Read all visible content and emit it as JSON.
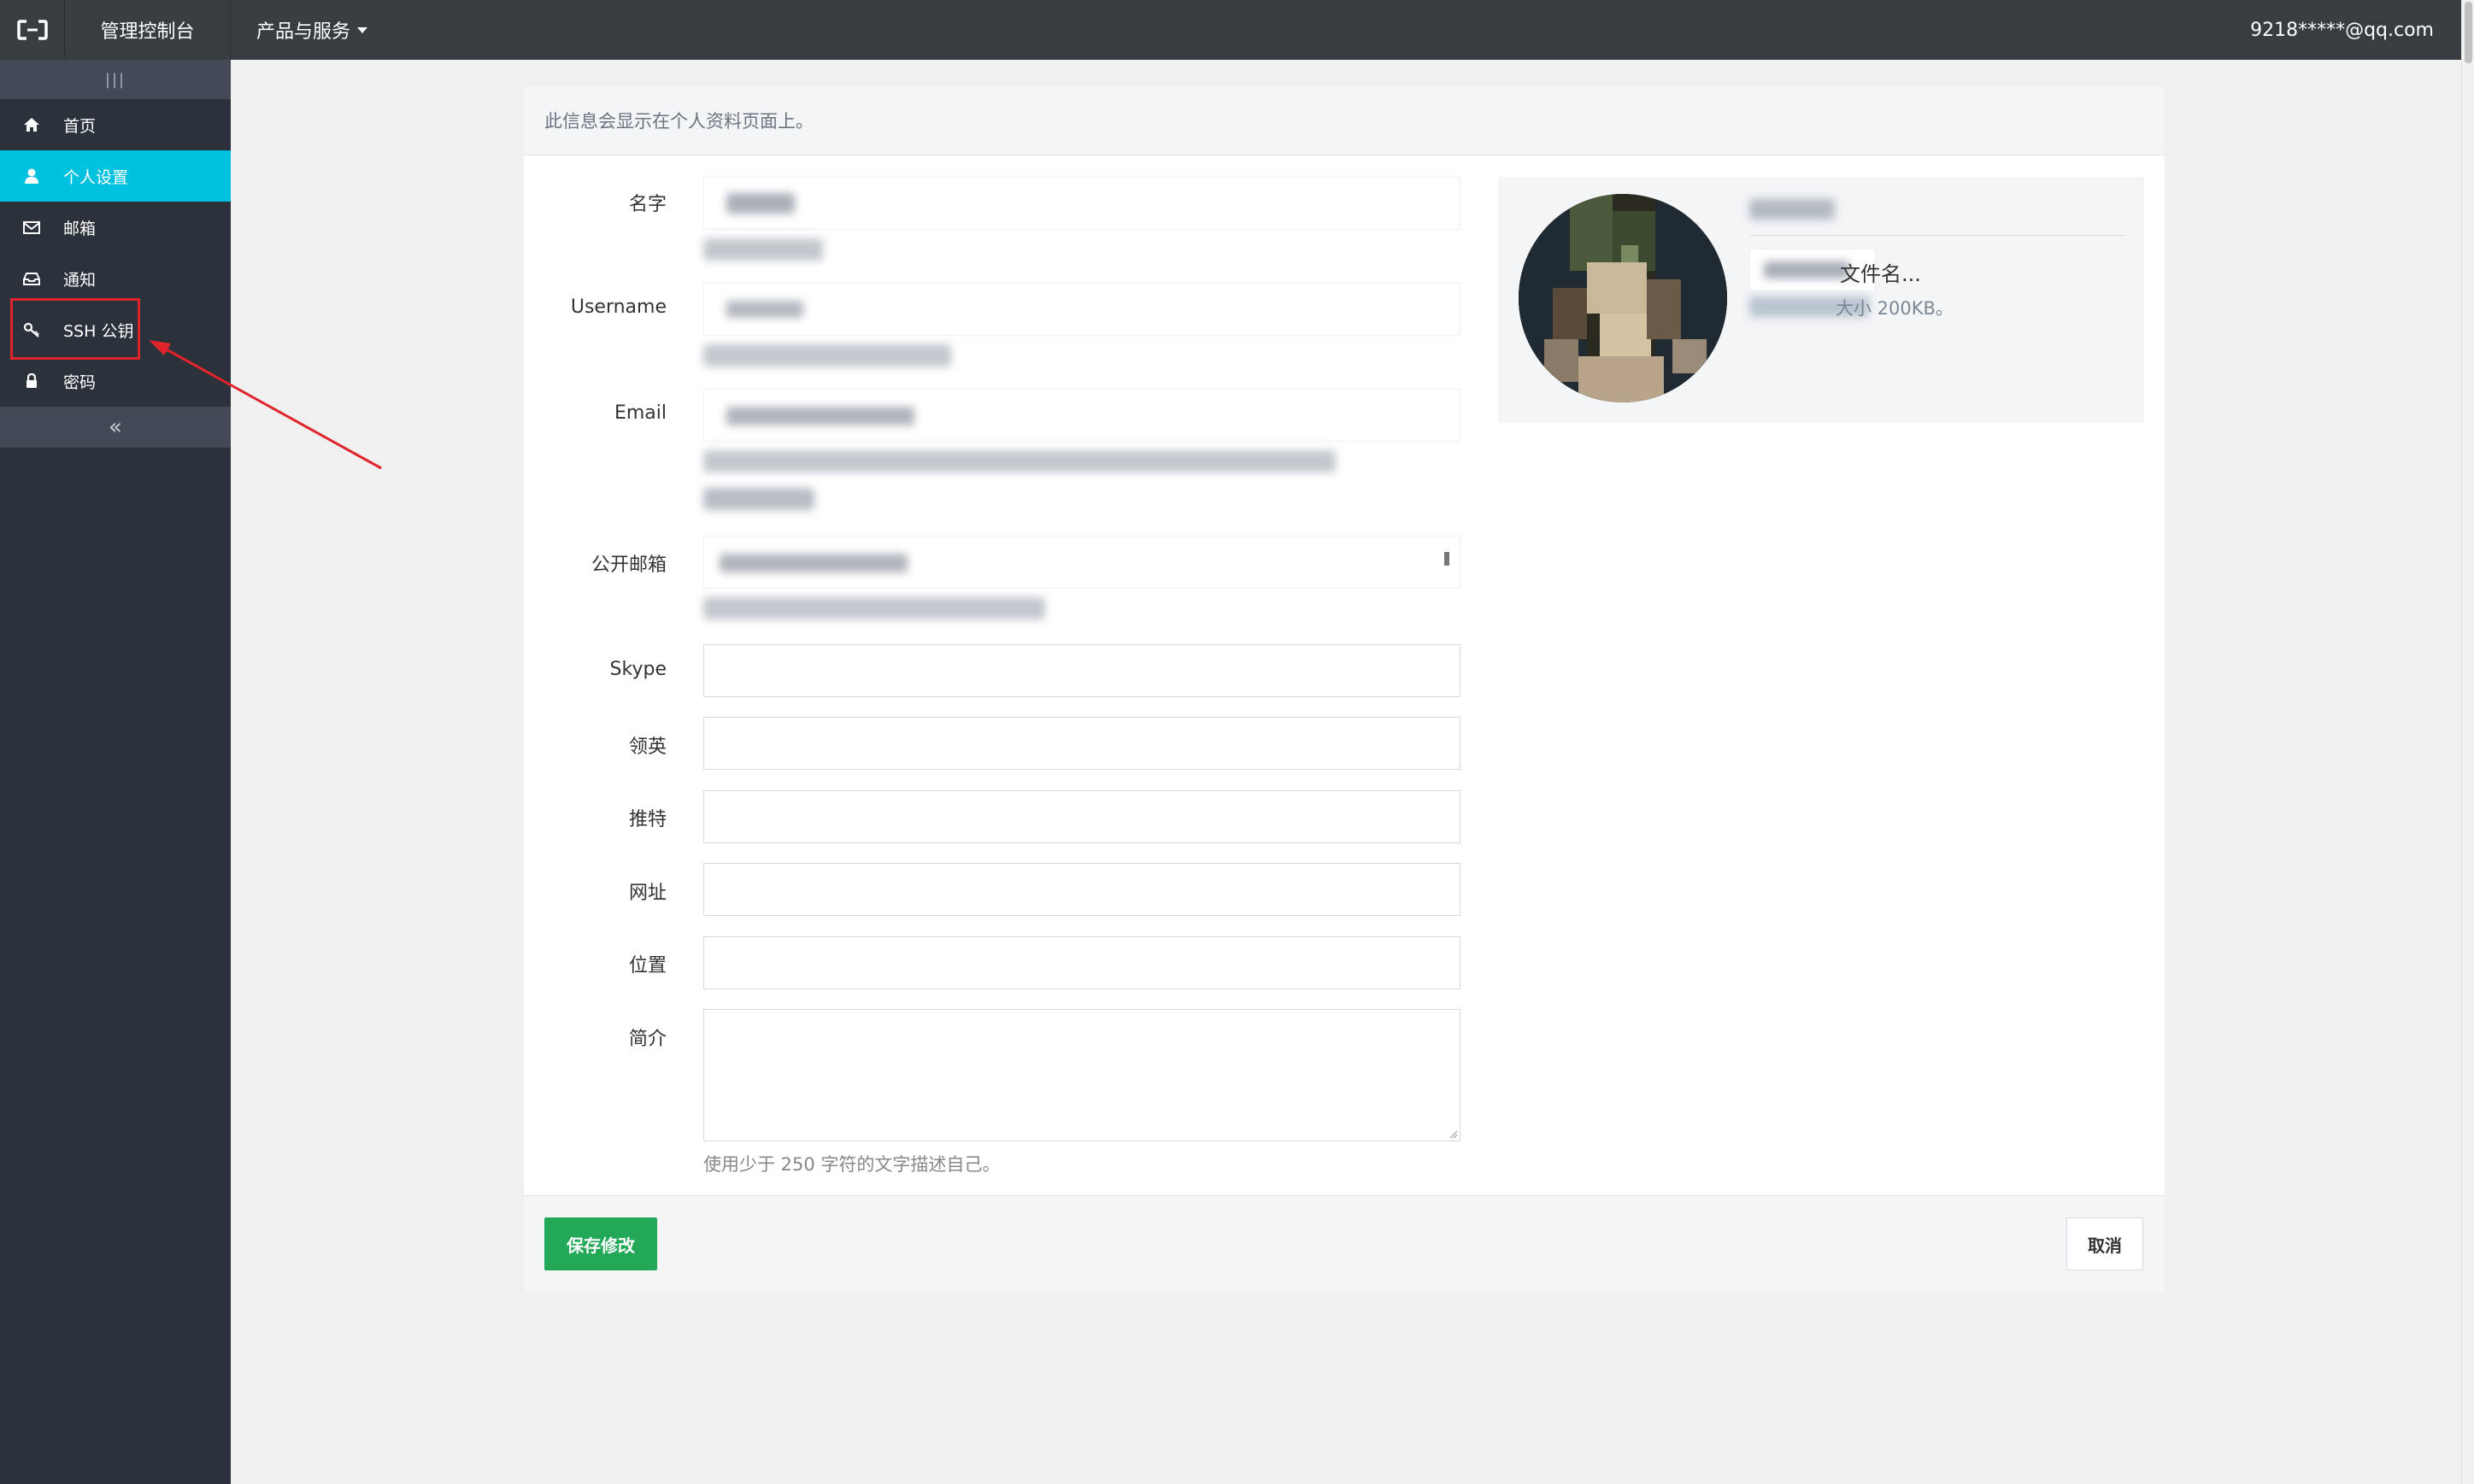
{
  "topbar": {
    "logo_icon": "aliyun-logo-icon",
    "title": "管理控制台",
    "products_menu": "产品与服务",
    "user_email": "9218*****@qq.com"
  },
  "sidebar": {
    "toggle_label": "|||",
    "collapse_label": "«",
    "active_color": "#00c1de",
    "items": [
      {
        "label": "首页",
        "icon": "home-icon"
      },
      {
        "label": "个人设置",
        "icon": "user-icon"
      },
      {
        "label": "邮箱",
        "icon": "envelope-icon"
      },
      {
        "label": "通知",
        "icon": "inbox-icon"
      },
      {
        "label": "SSH 公钥",
        "icon": "key-icon"
      },
      {
        "label": "密码",
        "icon": "lock-icon"
      }
    ]
  },
  "panel": {
    "header_text": "此信息会显示在个人资料页面上。",
    "fields": {
      "name_label": "名字",
      "username_label": "Username",
      "email_label": "Email",
      "public_email_label": "公开邮箱",
      "skype_label": "Skype",
      "linkedin_label": "领英",
      "twitter_label": "推特",
      "website_label": "网址",
      "location_label": "位置",
      "bio_label": "简介"
    },
    "bio_help": "使用少于 250 字符的文字描述自己。",
    "avatar": {
      "file_name_placeholder": "文件名...",
      "size_help": "大小 200KB。"
    },
    "save_button": "保存修改",
    "cancel_button": "取消",
    "save_color": "#23a858"
  }
}
